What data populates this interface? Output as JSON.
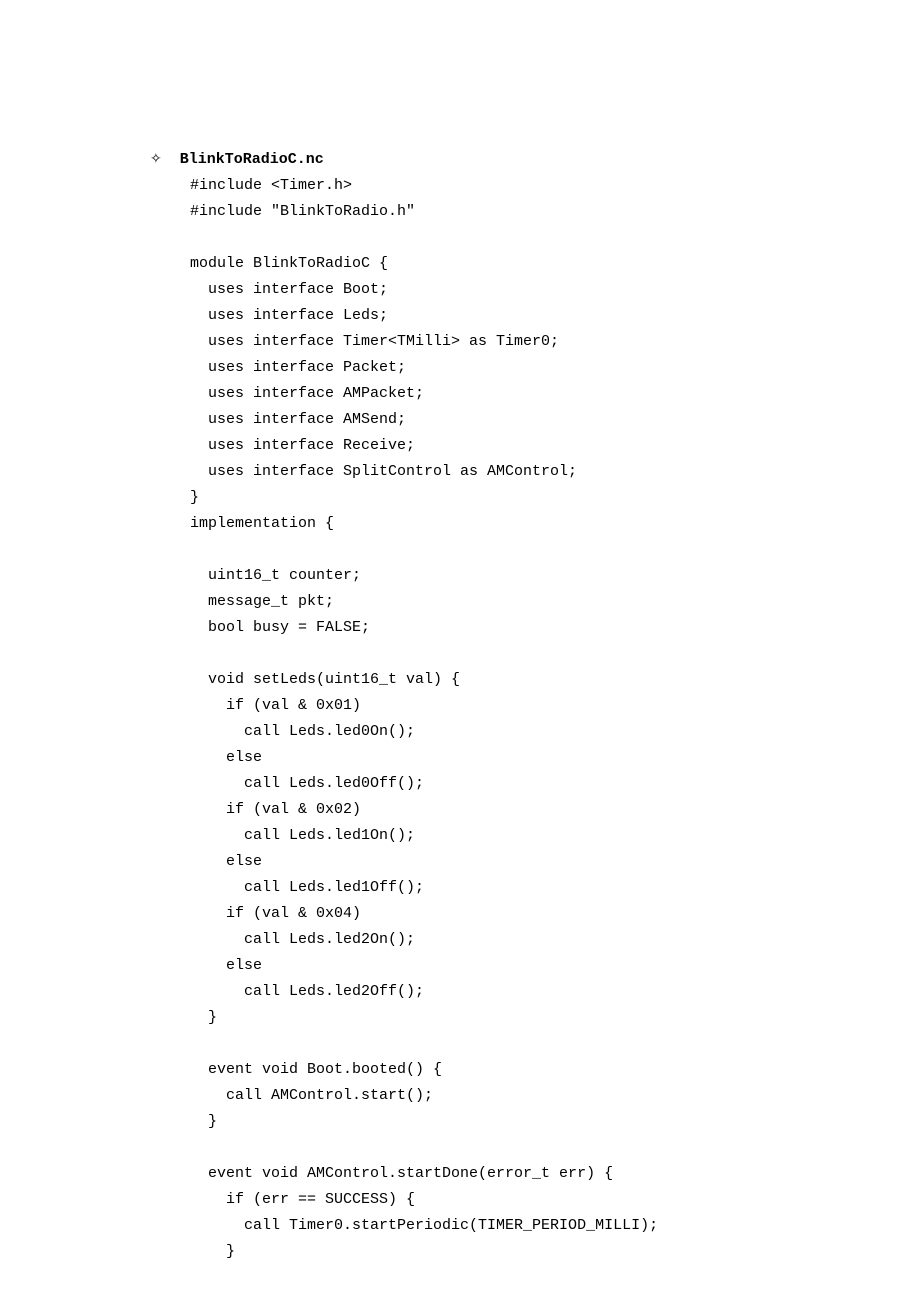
{
  "heading": "BlinkToRadioC.nc",
  "code": "#include <Timer.h>\n#include \"BlinkToRadio.h\"\n\nmodule BlinkToRadioC {\n  uses interface Boot;\n  uses interface Leds;\n  uses interface Timer<TMilli> as Timer0;\n  uses interface Packet;\n  uses interface AMPacket;\n  uses interface AMSend;\n  uses interface Receive;\n  uses interface SplitControl as AMControl;\n}\nimplementation {\n\n  uint16_t counter;\n  message_t pkt;\n  bool busy = FALSE;\n\n  void setLeds(uint16_t val) {\n    if (val & 0x01)\n      call Leds.led0On();\n    else\n      call Leds.led0Off();\n    if (val & 0x02)\n      call Leds.led1On();\n    else\n      call Leds.led1Off();\n    if (val & 0x04)\n      call Leds.led2On();\n    else\n      call Leds.led2Off();\n  }\n\n  event void Boot.booted() {\n    call AMControl.start();\n  }\n\n  event void AMControl.startDone(error_t err) {\n    if (err == SUCCESS) {\n      call Timer0.startPeriodic(TIMER_PERIOD_MILLI);\n    }"
}
